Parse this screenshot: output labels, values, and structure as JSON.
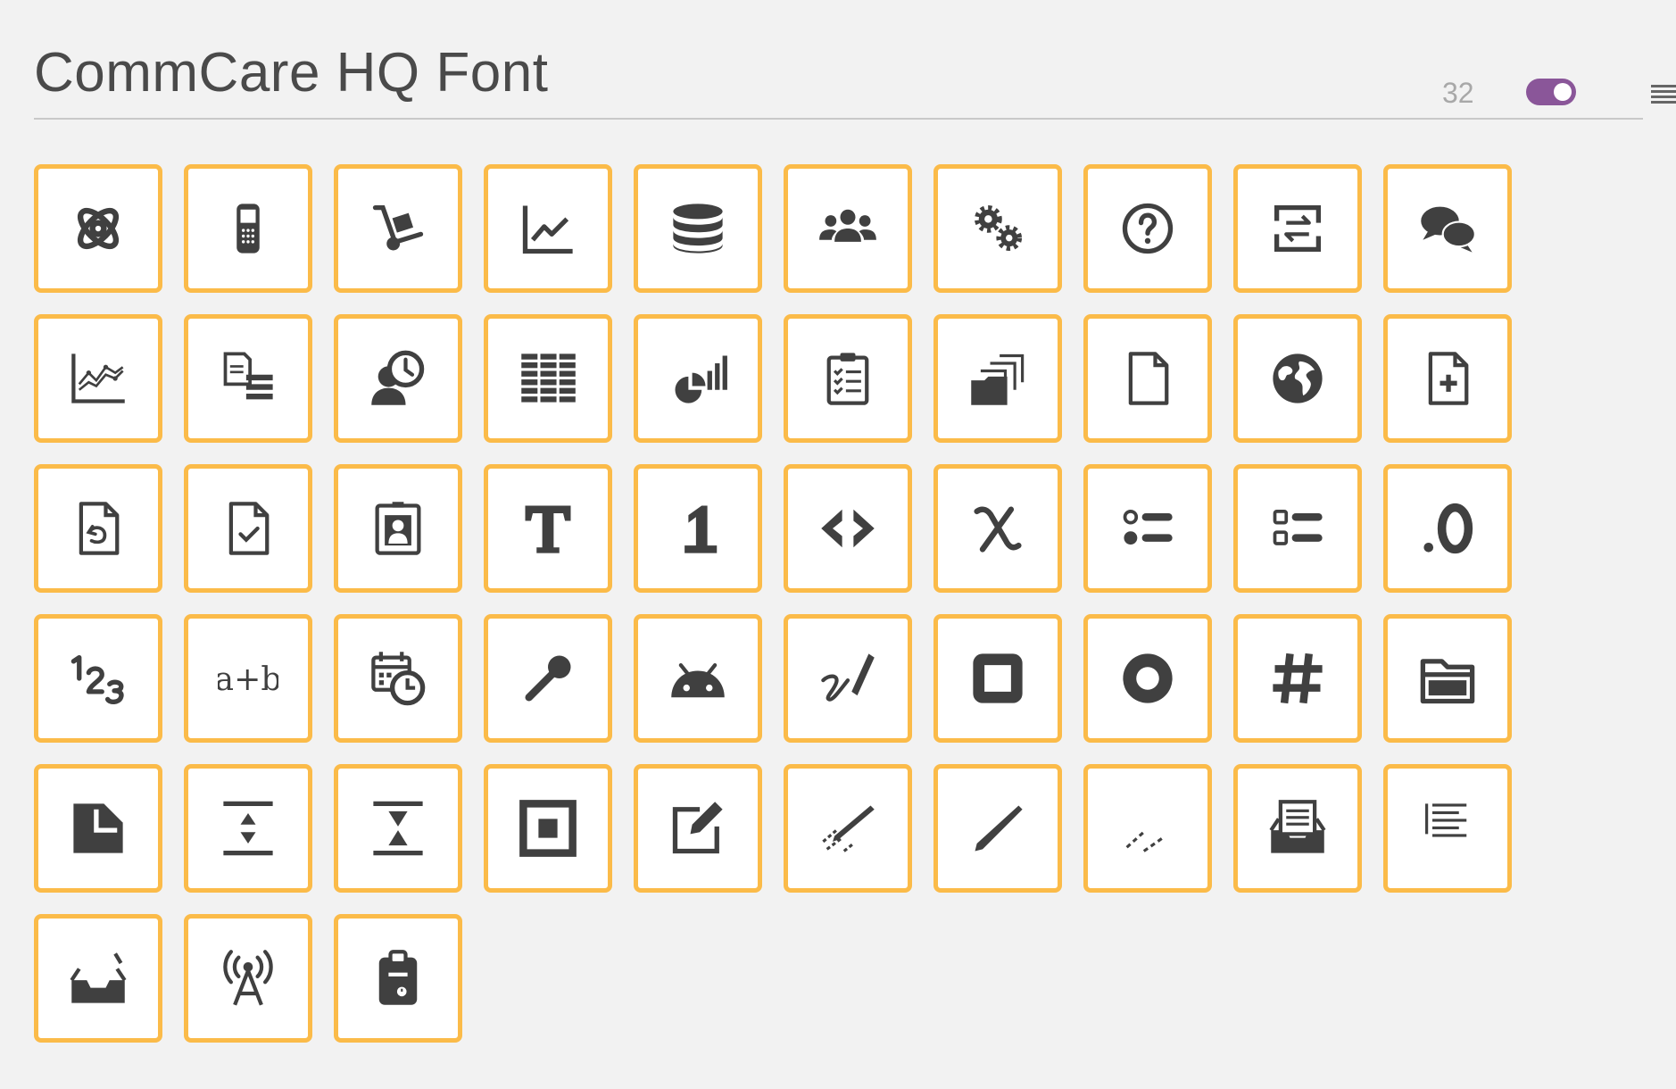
{
  "header": {
    "title": "CommCare HQ Font",
    "icon_size": "32",
    "toggle_on": true
  },
  "colors": {
    "background": "#f2f2f2",
    "tile_border": "#fbbb49",
    "icon": "#404040",
    "toggle": "#8a5699"
  },
  "icons": [
    "commcare-flower-icon",
    "flip-phone-icon",
    "hand-truck-icon",
    "line-chart-icon",
    "database-icon",
    "users-icon",
    "gears-icon",
    "help-circle-icon",
    "data-exchange-icon",
    "chat-bubbles-icon",
    "scatter-line-chart-icon",
    "document-list-icon",
    "user-clock-icon",
    "table-grid-icon",
    "pie-bar-chart-icon",
    "clipboard-checklist-icon",
    "folder-stack-icon",
    "blank-document-icon",
    "globe-icon",
    "add-document-icon",
    "return-document-icon",
    "checked-document-icon",
    "id-card-icon",
    "text-format-icon",
    "integer-icon",
    "code-brackets-icon",
    "chi-symbol-icon",
    "single-select-list-icon",
    "multi-select-list-icon",
    "decimal-icon",
    "number-sequence-icon",
    "a-plus-b-icon",
    "calendar-clock-icon",
    "microphone-icon",
    "android-icon",
    "signature-icon",
    "square-button-icon",
    "circle-button-icon",
    "hash-icon",
    "open-folder-icon",
    "folded-page-icon",
    "expand-vertical-icon",
    "collapse-vertical-icon",
    "nested-square-icon",
    "edit-note-icon",
    "multi-pencil-icon",
    "pencil-line-icon",
    "dashed-lines-icon",
    "inbox-document-icon",
    "text-lines-icon",
    "empty-inbox-icon",
    "broadcast-tower-icon",
    "clipboard-alert-icon"
  ]
}
